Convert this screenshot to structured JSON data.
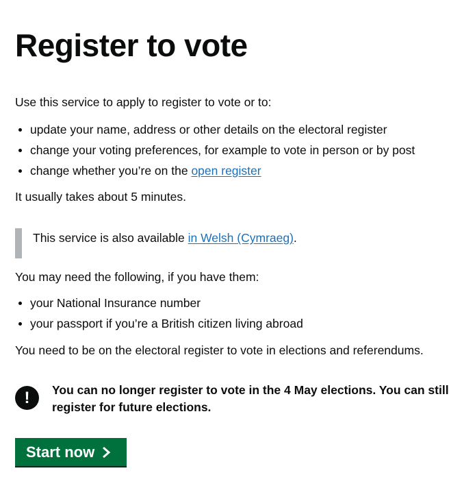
{
  "page": {
    "title": "Register to vote"
  },
  "intro": {
    "lead": "Use this service to apply to register to vote or to:",
    "items": [
      "update your name, address or other details on the electoral register",
      "change your voting preferences, for example to vote in person or by post"
    ],
    "open_register_prefix": "change whether you’re on the ",
    "open_register_link": "open register",
    "duration": "It usually takes about 5 minutes."
  },
  "inset": {
    "prefix": "This service is also available ",
    "link": "in Welsh (Cymraeg)",
    "suffix": "."
  },
  "need": {
    "lead": "You may need the following, if you have them:",
    "items": [
      "your National Insurance number",
      "your passport if you’re a British citizen living abroad"
    ],
    "register_note": "You need to be on the electoral register to vote in elections and referendums."
  },
  "warning": {
    "icon": "exclamation-icon",
    "icon_glyph": "!",
    "text": "You can no longer register to vote in the 4 May elections. You can still register for future elections."
  },
  "start_button": {
    "label": "Start now",
    "icon": "chevron-right-icon"
  },
  "colors": {
    "text": "#0b0c0c",
    "link": "#1d70b8",
    "button": "#00703c",
    "inset_border": "#b1b4b6"
  }
}
